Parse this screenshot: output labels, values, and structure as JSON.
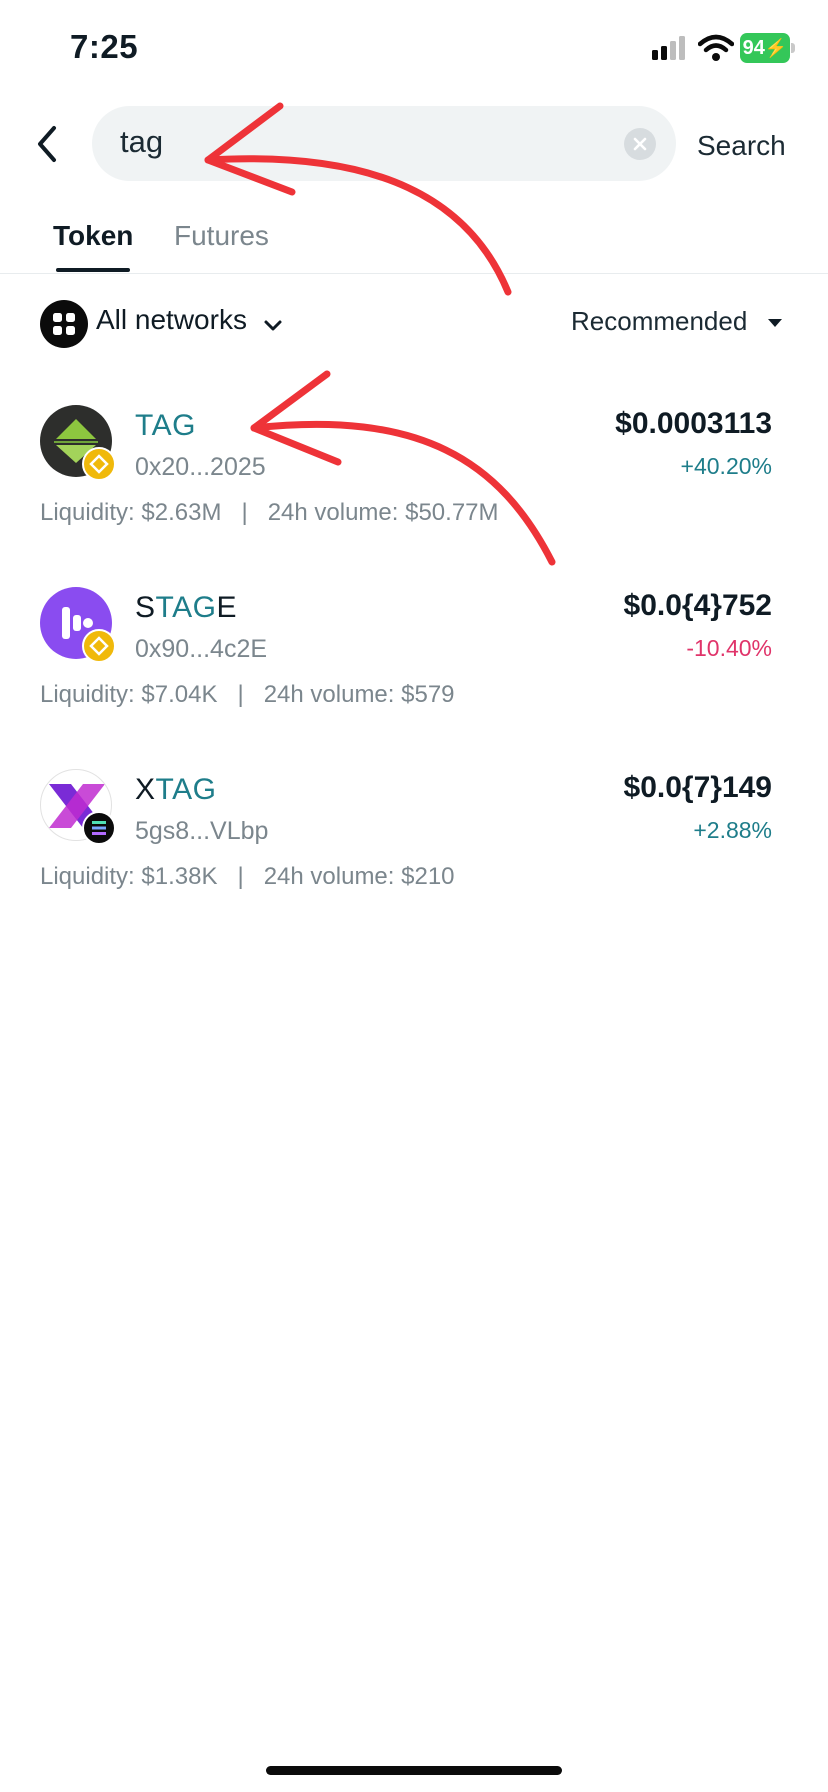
{
  "status_bar": {
    "time": "7:25",
    "battery": "94"
  },
  "search": {
    "value": "tag",
    "button_label": "Search"
  },
  "tabs": [
    {
      "label": "Token",
      "active": true
    },
    {
      "label": "Futures",
      "active": false
    }
  ],
  "filters": {
    "network_label": "All networks",
    "sort_label": "Recommended"
  },
  "colors": {
    "accent": "#1e7d8a",
    "positive": "#1e7d8a",
    "negative": "#e0346a",
    "annotation": "#ee3338"
  },
  "tokens": [
    {
      "name_pre": "",
      "name_match": "TAG",
      "name_post": "",
      "address": "0x20...2025",
      "price": "$0.0003113",
      "change": "+40.20%",
      "liquidity": "Liquidity: $2.63M",
      "volume": "24h volume: $50.77M",
      "chain": "bnb-icon"
    },
    {
      "name_pre": "S",
      "name_match": "TAG",
      "name_post": "E",
      "address": "0x90...4c2E",
      "price": "$0.0{4}752",
      "change": "-10.40%",
      "liquidity": "Liquidity: $7.04K",
      "volume": "24h volume: $579",
      "chain": "bnb-icon"
    },
    {
      "name_pre": "X",
      "name_match": "TAG",
      "name_post": "",
      "address": "5gs8...VLbp",
      "price": "$0.0{7}149",
      "change": "+2.88%",
      "liquidity": "Liquidity: $1.38K",
      "volume": "24h volume: $210",
      "chain": "solana-icon"
    }
  ],
  "separator": "|"
}
